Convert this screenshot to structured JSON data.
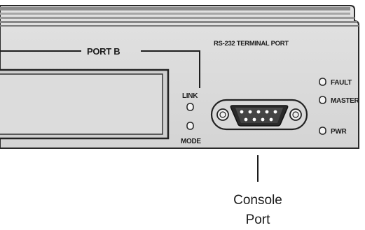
{
  "panel": {
    "port_b_label": "PORT B",
    "rs232_label": "RS-232 TERMINAL PORT",
    "link_label": "LINK",
    "mode_label": "MODE",
    "fault_label": "FAULT",
    "master_label": "MASTER",
    "pwr_label": "PWR"
  },
  "callout": {
    "line1": "Console",
    "line2": "Port"
  }
}
